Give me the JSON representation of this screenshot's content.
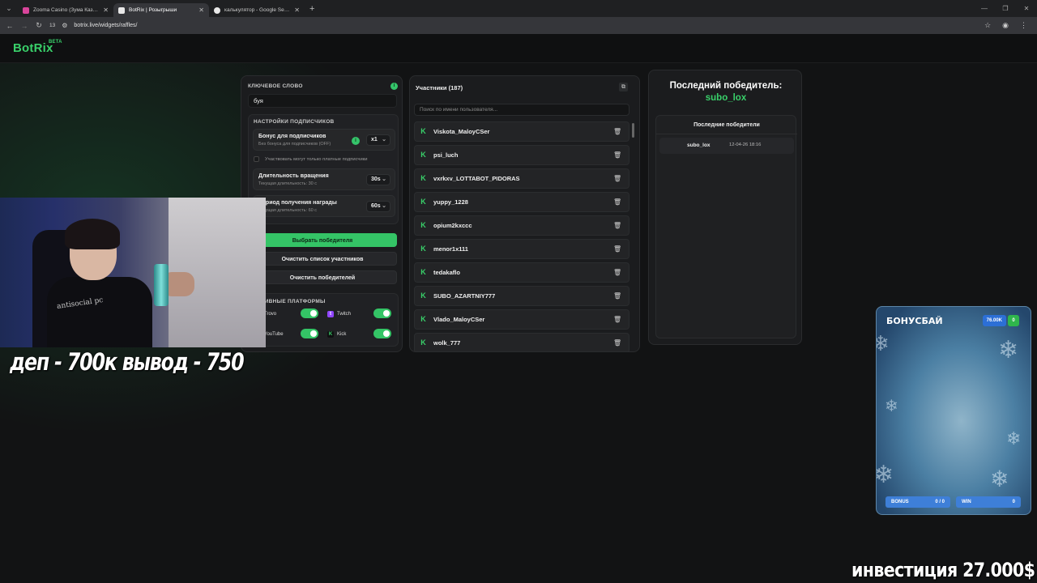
{
  "browser": {
    "tabs": [
      {
        "title": "Zooma Casino (Зума Казино)",
        "active": false,
        "favicon_color": "#d9459b"
      },
      {
        "title": "BotRix | Розыгрыши",
        "active": true,
        "favicon_color": "#39d06a"
      },
      {
        "title": "калькулятор - Google Search",
        "active": false,
        "favicon_color": "#e8e8e8"
      }
    ],
    "address": "botrix.live/widgets/raffles/",
    "tab_counter": "13"
  },
  "site": {
    "logo": "BotRix",
    "logo_badge": "BETA"
  },
  "left_panel": {
    "keyword_label": "КЛЮЧЕВОЕ СЛОВО",
    "keyword_value": "буя",
    "subscribers_label": "НАСТРОЙКИ ПОДПИСЧИКОВ",
    "bonus_title": "Бонус для подписчиков",
    "bonus_sub": "Без бонуса для подписчиков (OFF)",
    "bonus_value": "x1",
    "paid_only_label": "Участвовать могут только платные подписчики",
    "spin_title": "Длительность вращения",
    "spin_sub": "Текущая длительность: 30 с",
    "spin_value": "30s",
    "reward_title": "Период получения награды",
    "reward_sub": "Текущая длительность: 60 с",
    "reward_value": "60s",
    "btn_pick": "Выбрать победителя",
    "btn_clear_participants": "Очистить список участников",
    "btn_clear_winners": "Очистить победителей",
    "platforms_label": "АКТИВНЫЕ ПЛАТФОРМЫ",
    "platforms": [
      {
        "name": "Trovo",
        "color": "#1fd17d",
        "enabled": true
      },
      {
        "name": "Twitch",
        "color": "#9146ff",
        "enabled": true
      },
      {
        "name": "YouTube",
        "color": "#ff2b2b",
        "enabled": true
      },
      {
        "name": "Kick",
        "color": "#39d06a",
        "enabled": true
      }
    ]
  },
  "participants": {
    "title": "Участники (187)",
    "search_placeholder": "Поиск по имени пользователя...",
    "list": [
      "Viskota_MaloyCSer",
      "psi_luch",
      "vxrkxv_LOTTABOT_PIDORAS",
      "yuppy_1228",
      "opium2kxccc",
      "menor1x111",
      "tedakaflo",
      "SUBO_AZARTNIY777",
      "Vlado_MaloyCSer",
      "wolk_777"
    ]
  },
  "winners": {
    "last_title": "Последний победитель:",
    "last_name": "subo_lox",
    "list_title": "Последние победители",
    "rows": [
      {
        "name": "subo_lox",
        "date": "12-04-26 18:16"
      }
    ]
  },
  "overlay": {
    "caption": "деп - 700к вывод - 750",
    "invest": "инвестиция 27.000$",
    "bonus_title": "БОНУСБАЙ",
    "bonus_amount": "76.00K",
    "bonus_count": "0",
    "bonus_label": "BONUS",
    "bonus_value": "0 / 0",
    "win_label": "WIN",
    "win_value": "0",
    "shirt_text": "antisocial pc"
  }
}
